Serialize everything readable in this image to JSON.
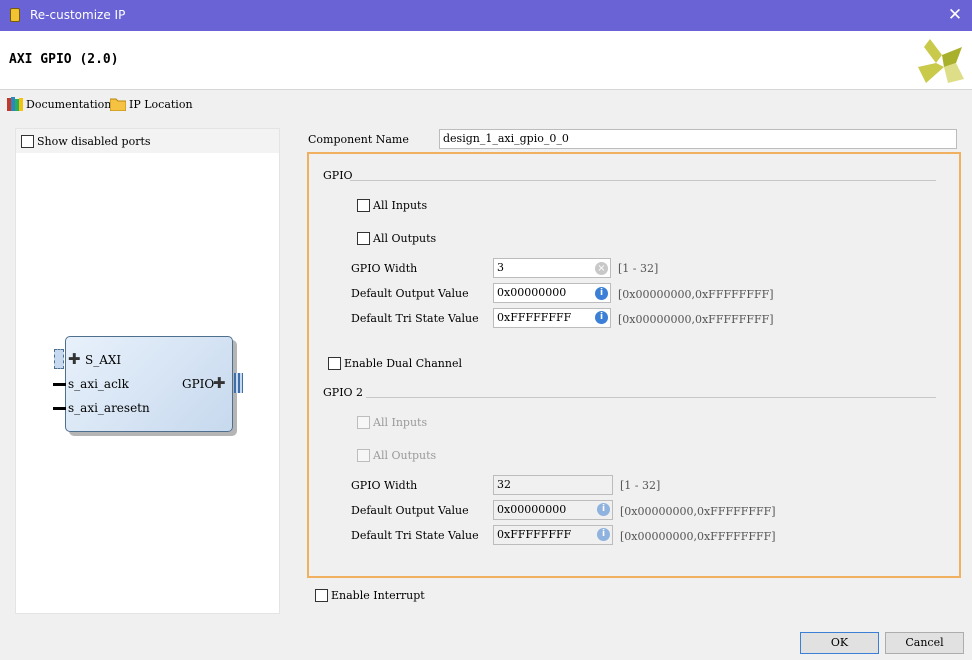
{
  "window": {
    "title": "Re-customize IP",
    "close_glyph": "✕"
  },
  "header": {
    "ip_title": "AXI GPIO (2.0)"
  },
  "toolbar": {
    "documentation": {
      "label": "Documentation",
      "icon": "books-icon"
    },
    "ip_location": {
      "label": "IP Location",
      "icon": "folder-icon"
    }
  },
  "left_panel": {
    "show_disabled_ports": "Show disabled ports",
    "block": {
      "ports_left": [
        "S_AXI",
        "s_axi_aclk",
        "s_axi_aresetn"
      ],
      "port_right": "GPIO"
    }
  },
  "component": {
    "label": "Component Name",
    "value": "design_1_axi_gpio_0_0"
  },
  "gpio": {
    "section": "GPIO",
    "all_inputs": "All Inputs",
    "all_outputs": "All Outputs",
    "width_label": "GPIO Width",
    "width_value": "3",
    "width_range": "[1 - 32]",
    "default_output_label": "Default Output Value",
    "default_output_value": "0x00000000",
    "default_output_range": "[0x00000000,0xFFFFFFFF]",
    "tri_state_label": "Default Tri State Value",
    "tri_state_value": "0xFFFFFFFF",
    "tri_state_range": "[0x00000000,0xFFFFFFFF]"
  },
  "dual_channel": {
    "label": "Enable Dual Channel"
  },
  "gpio2": {
    "section": "GPIO 2",
    "all_inputs": "All Inputs",
    "all_outputs": "All Outputs",
    "width_label": "GPIO Width",
    "width_value": "32",
    "width_range": "[1 - 32]",
    "default_output_label": "Default Output Value",
    "default_output_value": "0x00000000",
    "default_output_range": "[0x00000000,0xFFFFFFFF]",
    "tri_state_label": "Default Tri State Value",
    "tri_state_value": "0xFFFFFFFF",
    "tri_state_range": "[0x00000000,0xFFFFFFFF]"
  },
  "interrupt": {
    "label": "Enable Interrupt"
  },
  "buttons": {
    "ok": "OK",
    "cancel": "Cancel"
  },
  "colors": {
    "title_bar": "#6a63d6",
    "accent_border": "#f0b060",
    "info": "#3b7fd6"
  }
}
